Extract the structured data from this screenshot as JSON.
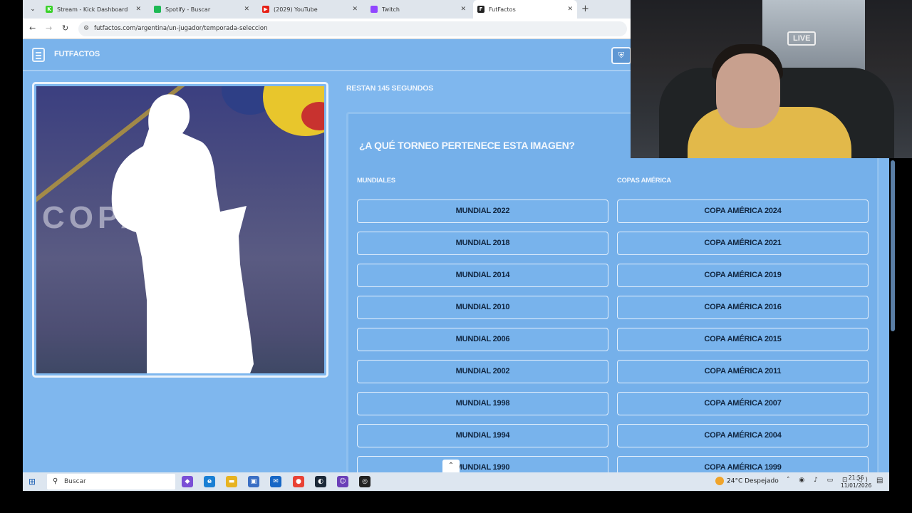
{
  "browser": {
    "tabs": [
      {
        "title": "Stream - Kick Dashboard",
        "icon": "kick-icon",
        "icon_color": "#3bd12a",
        "icon_glyph": "K"
      },
      {
        "title": "Spotify - Buscar",
        "icon": "spotify-icon",
        "icon_color": "#1db954",
        "icon_glyph": ""
      },
      {
        "title": "(2029) YouTube",
        "icon": "youtube-icon",
        "icon_color": "#e62117",
        "icon_glyph": "▶"
      },
      {
        "title": "Twitch",
        "icon": "twitch-icon",
        "icon_color": "#9146ff",
        "icon_glyph": ""
      },
      {
        "title": "FutFactos",
        "icon": "futfactos-icon",
        "icon_color": "#222",
        "icon_glyph": "F"
      }
    ],
    "new_tab_glyph": "+",
    "url": "futfactos.com/argentina/un-jugador/temporada-seleccion"
  },
  "site": {
    "logo_text": "FUTFACTOS",
    "timer_text": "RESTAN 145 SEGUNDOS",
    "photo_watermark": "COPA"
  },
  "quiz": {
    "question": "¿A QUÉ TORNEO PERTENECE ESTA IMAGEN?",
    "col_mundiales": "MUNDIALES",
    "col_copas": "COPAS AMÉRICA",
    "mundiales": [
      "MUNDIAL 2022",
      "MUNDIAL 2018",
      "MUNDIAL 2014",
      "MUNDIAL 2010",
      "MUNDIAL 2006",
      "MUNDIAL 2002",
      "MUNDIAL 1998",
      "MUNDIAL 1994",
      "MUNDIAL 1990"
    ],
    "copas": [
      "COPA AMÉRICA 2024",
      "COPA AMÉRICA 2021",
      "COPA AMÉRICA 2019",
      "COPA AMÉRICA 2016",
      "COPA AMÉRICA 2015",
      "COPA AMÉRICA 2011",
      "COPA AMÉRICA 2007",
      "COPA AMÉRICA 2004",
      "COPA AMÉRICA 1999"
    ]
  },
  "webcam": {
    "live_label": "LIVE"
  },
  "taskbar": {
    "search_placeholder": "Buscar",
    "weather": "24°C Despejado",
    "time": "21:56",
    "date": "11/01/2026"
  }
}
